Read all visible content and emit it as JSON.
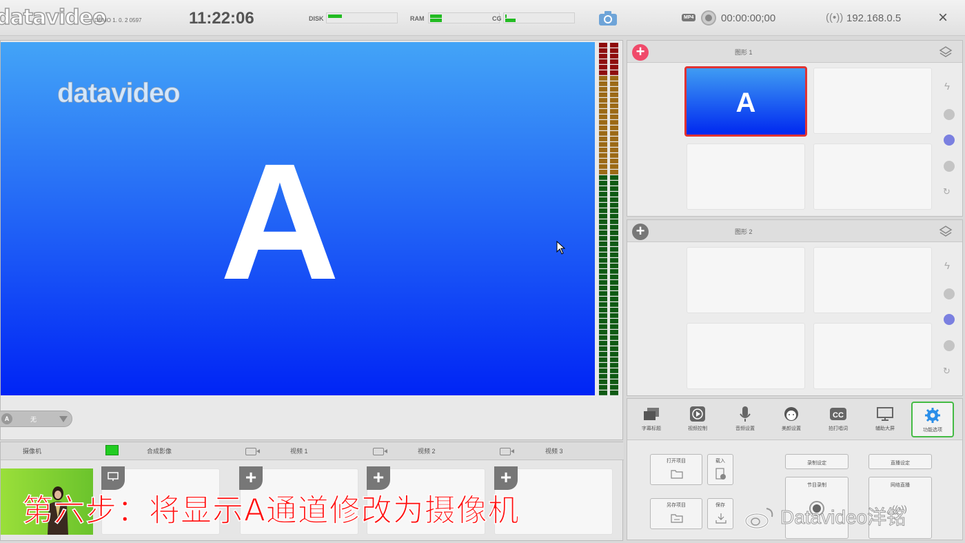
{
  "topbar": {
    "logo": "datavideo",
    "version": "DEMO 1. 0. 2 0597",
    "clock": "11:22:06",
    "disk_label": "DISK",
    "ram_label": "RAM",
    "cg_label": "CG",
    "disk_usage": 0.2,
    "ram_usage": 0.18,
    "cg_usage": 0.15,
    "record_format": "MP4",
    "timecode": "00:00:00;00",
    "ip": "192.168.0.5",
    "close_icon": "×",
    "signal_icon": "((•))"
  },
  "preview": {
    "watermark": "datavideo",
    "letter": "A",
    "channel_badge": "A",
    "channel_value": "无",
    "gradient_top": "#43a4f7",
    "gradient_bottom": "#0024f5"
  },
  "sources": {
    "labels": [
      "摄像机",
      "合成影像",
      "视频 1",
      "视频 2",
      "视频 3"
    ],
    "add_symbol": "+"
  },
  "subtitle": "第六步：将显示A通道修改为摄像机",
  "graphics": [
    {
      "title": "图形 1",
      "add_symbol": "+",
      "add_color": "#f04a6a",
      "selected_letter": "A"
    },
    {
      "title": "图形 2",
      "add_symbol": "+",
      "add_color": "#777777"
    }
  ],
  "side_icons": {
    "bolt": "ϟ",
    "loop": "↻"
  },
  "functions": [
    {
      "label": "字幕标题",
      "icon": "titles-icon"
    },
    {
      "label": "视频控制",
      "icon": "play-icon"
    },
    {
      "label": "音频设置",
      "icon": "microphone-icon"
    },
    {
      "label": "美颜设置",
      "icon": "face-icon"
    },
    {
      "label": "拍打唱词",
      "icon": "cc-icon"
    },
    {
      "label": "辅助大屏",
      "icon": "monitor-icon"
    },
    {
      "label": "功能选项",
      "icon": "gear-icon",
      "active": true
    }
  ],
  "actions": {
    "open_project": "打开项目",
    "load": "载入",
    "save_as": "另存项目",
    "save": "保存",
    "record_settings": "录制设定",
    "stream_settings": "直播设定",
    "program_record": "节目录制",
    "network_stream": "网络直播"
  },
  "watermark": "Datavideo洋铭",
  "colors": {
    "active_green": "#44bb44",
    "selected_red": "#e03333",
    "active_dot": "#7b80e0"
  }
}
